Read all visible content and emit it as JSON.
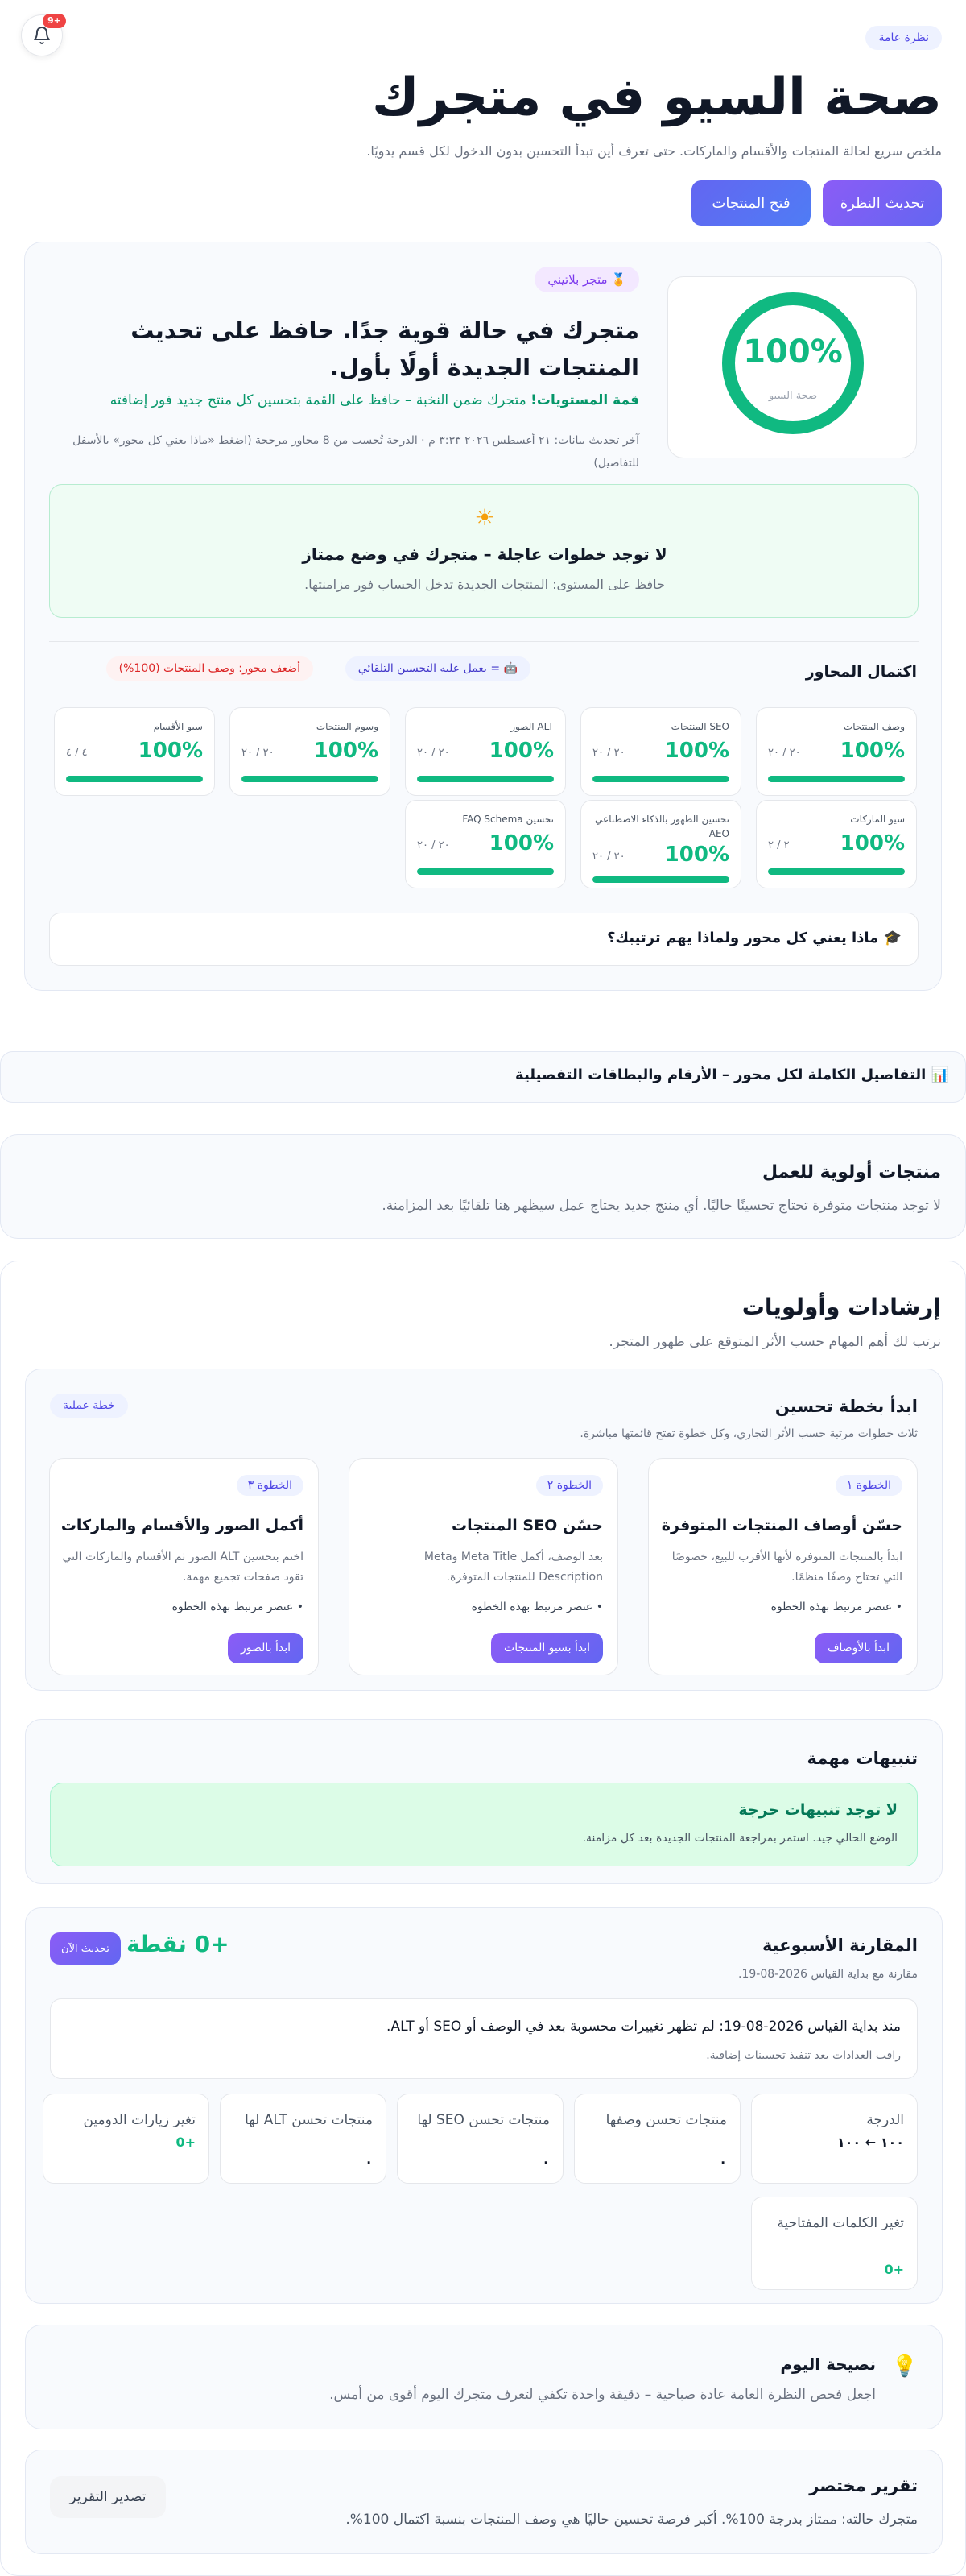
{
  "notifications": {
    "badge": "+9"
  },
  "header": {
    "pill": "نظرة عامة",
    "title": "صحة السيو في متجرك",
    "subtitle": "ملخص سريع لحالة المنتجات والأقسام والماركات. حتى تعرف أين تبدأ التحسين بدون الدخول لكل قسم يدويًا.",
    "refresh_label": "تحديث النظرة",
    "open_products_label": "فتح المنتجات"
  },
  "health": {
    "score": "100%",
    "score_fraction": 1.0,
    "score_caption": "صحة السيو",
    "tier_badge": "🏅 متجر بلاتيني",
    "headline": "متجرك في حالة قوية جدًا. حافظ على تحديث المنتجات الجديدة أولًا بأول.",
    "level_strong": "قمة المستويات!",
    "level_text": " متجرك ضمن النخبة – حافظ على القمة بتحسين كل منتج جديد فور إضافته",
    "meta": "آخر تحديث بيانات: ٢١ أغسطس ٢٠٢٦ ٣:٣٣ م · الدرجة تُحسب من 8 محاور مرجحة (اضغط «ماذا يعني كل محور» بالأسفل للتفاصيل)",
    "no_steps_icon": "☀",
    "no_steps_title": "لا توجد خطوات عاجلة – متجرك في وضع ممتاز",
    "no_steps_sub": "حافظ على المستوى: المنتجات الجديدة تدخل الحساب فور مزامنتها.",
    "colors": {
      "accent": "#10b981",
      "brand": "#6366f1"
    }
  },
  "axes": {
    "title": "اكتمال المحاور",
    "auto_pill": "🤖 = يعمل عليه التحسين التلقائي",
    "weakest_pill": "أضعف محور: وصف المنتجات (100%)",
    "tiles": [
      {
        "name": "وصف المنتجات",
        "pct": "100%",
        "count": "٢٠ / ٢٠",
        "fill": 1.0
      },
      {
        "name": "SEO المنتجات",
        "pct": "100%",
        "count": "٢٠ / ٢٠",
        "fill": 1.0
      },
      {
        "name": "ALT الصور",
        "pct": "100%",
        "count": "٢٠ / ٢٠",
        "fill": 1.0
      },
      {
        "name": "وسوم المنتجات",
        "pct": "100%",
        "count": "٢٠ / ٢٠",
        "fill": 1.0
      },
      {
        "name": "سيو الأقسام",
        "pct": "100%",
        "count": "٤ / ٤",
        "fill": 1.0
      },
      {
        "name": "سيو الماركات",
        "pct": "100%",
        "count": "٢ / ٢",
        "fill": 1.0
      },
      {
        "name": "تحسين الظهور بالذكاء الاصطناعي AEO",
        "pct": "100%",
        "count": "٢٠ / ٢٠",
        "fill": 1.0
      },
      {
        "name": "تحسين FAQ Schema",
        "pct": "100%",
        "count": "٢٠ / ٢٠",
        "fill": 1.0
      }
    ],
    "faq": "🎓 ماذا يعني كل محور ولماذا يهم ترتيبك؟"
  },
  "details": {
    "label": "📊 التفاصيل الكاملة لكل محور – الأرقام والبطاقات التفصيلية"
  },
  "priority": {
    "title": "منتجات أولوية للعمل",
    "text": "لا توجد منتجات متوفرة تحتاج تحسينًا حاليًا. أي منتج جديد يحتاج عمل سيظهر هنا تلقائيًا بعد المزامنة."
  },
  "guides": {
    "title": "إرشادات وأولويات",
    "subtitle": "نرتب لك أهم المهام حسب الأثر المتوقع على ظهور المتجر.",
    "plan": {
      "title": "ابدأ بخطة تحسين",
      "subtitle": "ثلاث خطوات مرتبة حسب الأثر التجاري، وكل خطوة تفتح قائمتها مباشرة.",
      "pill": "خطة عملية",
      "steps": [
        {
          "num": "الخطوة ١",
          "title": "حسّن أوصاف المنتجات المتوفرة",
          "desc": "ابدأ بالمنتجات المتوفرة لأنها الأقرب للبيع، خصوصًا التي تحتاج وصفًا منظمًا.",
          "linked": "• عنصر مرتبط بهذه الخطوة",
          "cta": "ابدأ بالأوصاف"
        },
        {
          "num": "الخطوة ٢",
          "title": "حسّن SEO المنتجات",
          "desc": "بعد الوصف، أكمل Meta Title وMeta Description للمنتجات المتوفرة.",
          "linked": "• عنصر مرتبط بهذه الخطوة",
          "cta": "ابدأ بسيو المنتجات"
        },
        {
          "num": "الخطوة ٣",
          "title": "أكمل الصور والأقسام والماركات",
          "desc": "اختم بتحسين ALT الصور ثم الأقسام والماركات التي تقود صفحات تجميع مهمة.",
          "linked": "• عنصر مرتبط بهذه الخطوة",
          "cta": "ابدأ بالصور"
        }
      ]
    },
    "alerts": {
      "title": "تنبيهات مهمة",
      "ok_title": "لا توجد تنبيهات حرجة",
      "ok_text": "الوضع الحالي جيد. استمر بمراجعة المنتجات الجديدة بعد كل مزامنة."
    },
    "weekly": {
      "title": "المقارنة الأسبوعية",
      "subtitle": "مقارنة مع بداية القياس 2026-08-19.",
      "points": "+0 نقطة",
      "now_label": "تحديث الآن",
      "since_text": "منذ بداية القياس 2026-08-19: لم تظهر تغييرات محسوبة بعد في الوصف أو SEO أو ALT.",
      "since_sub": "راقب العدادات بعد تنفيذ تحسينات إضافية.",
      "metrics": [
        {
          "label": "الدرجة",
          "value": "١٠٠ ← ١٠٠",
          "green": false
        },
        {
          "label": "منتجات تحسن وصفها",
          "value": "٠",
          "green": false
        },
        {
          "label": "منتجات تحسن SEO لها",
          "value": "٠",
          "green": false
        },
        {
          "label": "منتجات تحسن ALT لها",
          "value": "٠",
          "green": false
        },
        {
          "label": "تغير زيارات الدومين",
          "value": "+0",
          "green": true
        },
        {
          "label": "تغير الكلمات المفتاحية",
          "value": "+0",
          "green": true
        }
      ]
    },
    "tip": {
      "icon": "💡",
      "title": "نصيحة اليوم",
      "text": "اجعل فحص النظرة العامة عادة صباحية – دقيقة واحدة تكفي لتعرف متجرك اليوم أقوى من أمس."
    },
    "report": {
      "title": "تقرير مختصر",
      "text": "متجرك حالته: ممتاز بدرجة 100%. أكبر فرصة تحسين حاليًا هي وصف المنتجات بنسبة اكتمال 100%.",
      "export_label": "تصدير التقرير"
    }
  }
}
